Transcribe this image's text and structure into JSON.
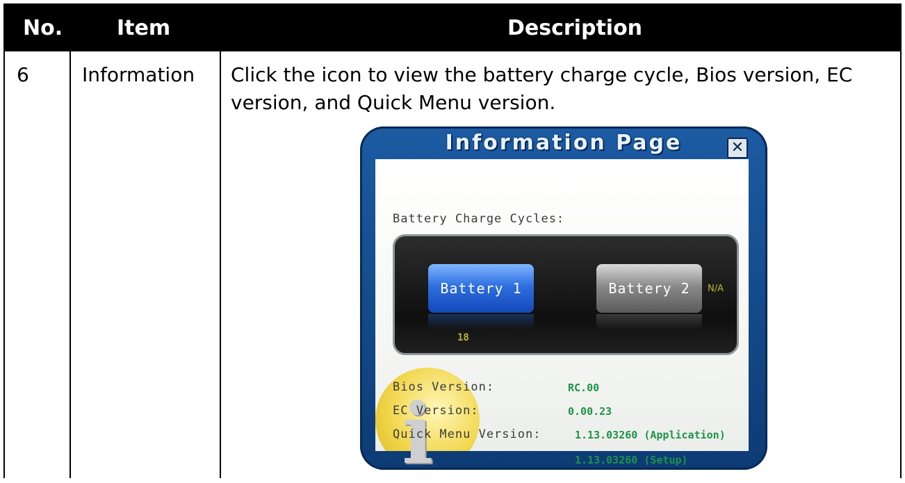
{
  "table": {
    "headers": {
      "no": "No.",
      "item": "Item",
      "description": "Description"
    },
    "row": {
      "no": "6",
      "item": "Information",
      "description": "Click the icon to view the battery charge cycle, Bios version, EC version, and Quick Menu version."
    }
  },
  "window": {
    "title": "Information Page",
    "close_icon": "close-icon",
    "battery_cycles_label": "Battery Charge Cycles:",
    "batteries": [
      {
        "label": "Battery 1",
        "cycles": "18",
        "color": "#2e6fe0"
      },
      {
        "label": "Battery 2",
        "status": "N/A",
        "color": "#8a8a8a"
      }
    ],
    "bios_label": "Bios Version:",
    "bios_value": "RC.00",
    "ec_label": "EC Version:",
    "ec_value": "0.00.23",
    "quick_menu_label": "Quick Menu Version:",
    "quick_menu_app": "1.13.03260 (Application)",
    "quick_menu_setup": "1.13.03260 (Setup)",
    "info_icon": "information-icon"
  },
  "colors": {
    "header_bg": "#000000",
    "window_frame": "#1c5ba3",
    "value_green": "#1d9447",
    "count_yellow": "#b6b43a"
  }
}
